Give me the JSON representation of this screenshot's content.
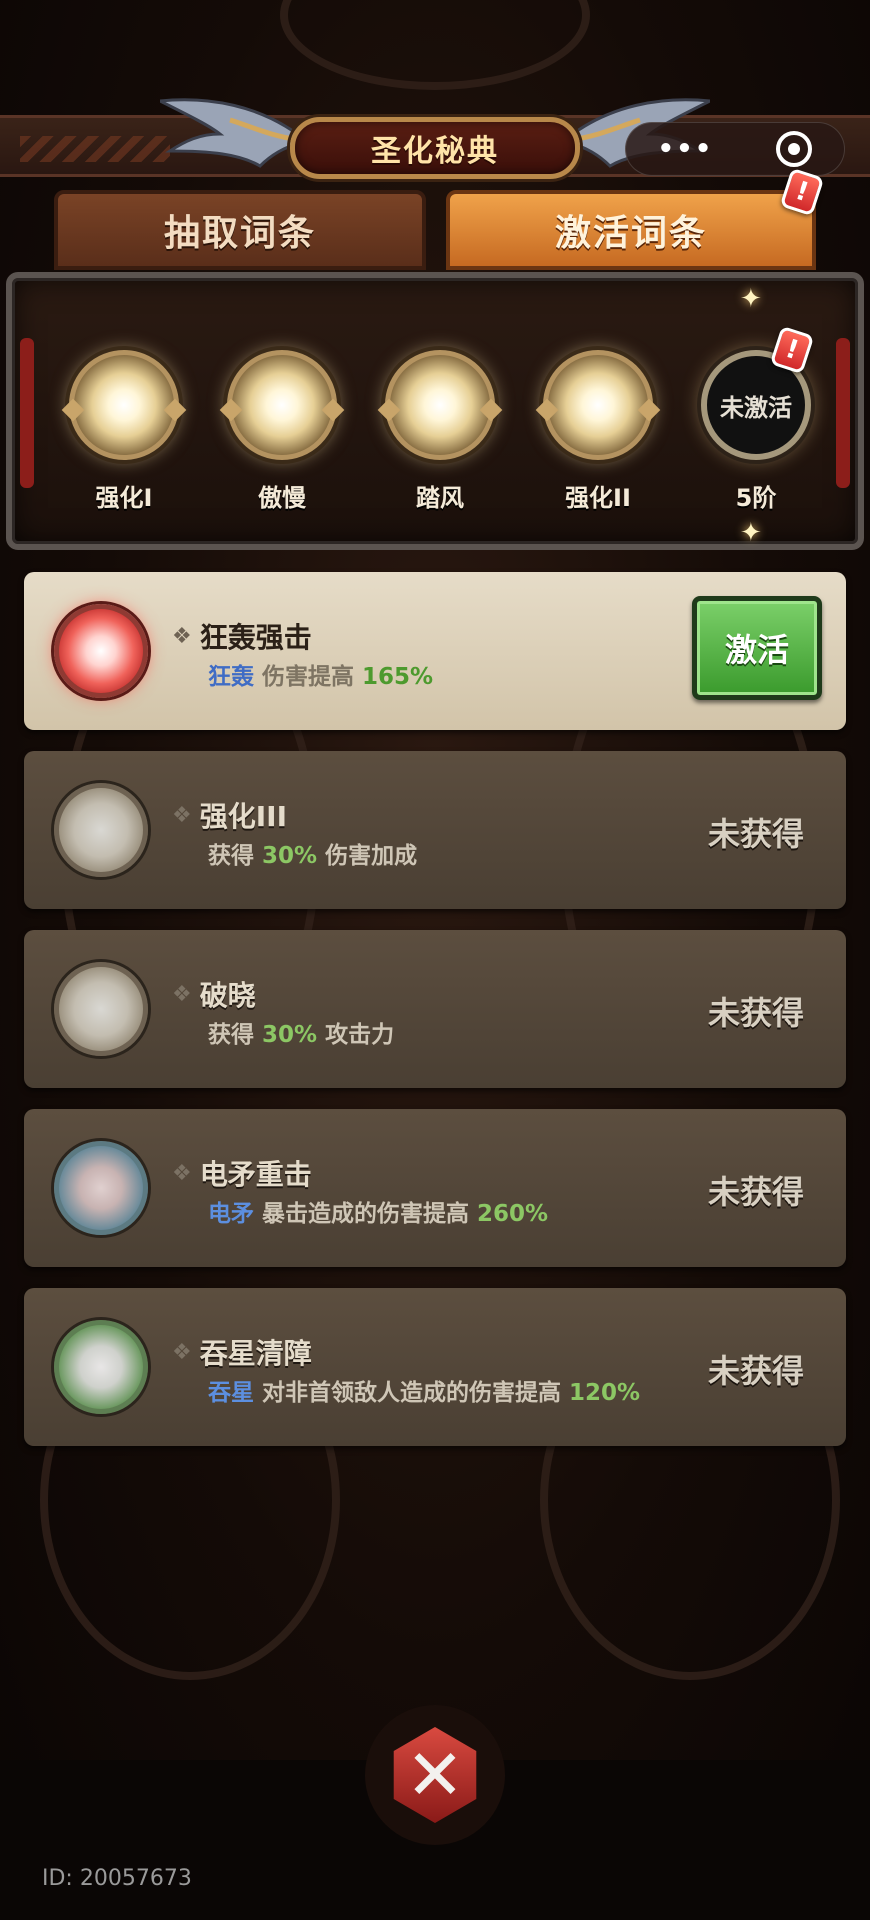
{
  "header": {
    "title": "圣化秘典"
  },
  "capsule": {
    "more": "•••"
  },
  "tabs": [
    {
      "label": "抽取词条"
    },
    {
      "label": "激活词条",
      "badge": "!"
    }
  ],
  "ranks": [
    {
      "label": "强化I"
    },
    {
      "label": "傲慢"
    },
    {
      "label": "踏风"
    },
    {
      "label": "强化II"
    },
    {
      "label": "5阶",
      "orb_text": "未激活",
      "badge": "!"
    }
  ],
  "entries": [
    {
      "name": "狂轰强击",
      "keyword": "狂轰",
      "text": "伤害提高",
      "value": "165%",
      "action": "激活",
      "gem": "red"
    },
    {
      "name": "强化III",
      "prefix": "获得",
      "value": "30%",
      "text": "伤害加成",
      "status": "未获得",
      "gem": "beige"
    },
    {
      "name": "破晓",
      "prefix": "获得",
      "value": "30%",
      "text": "攻击力",
      "status": "未获得",
      "gem": "beige"
    },
    {
      "name": "电矛重击",
      "keyword": "电矛",
      "text": "暴击造成的伤害提高",
      "value": "260%",
      "status": "未获得",
      "gem": "blue"
    },
    {
      "name": "吞星清障",
      "keyword": "吞星",
      "text": "对非首领敌人造成的伤害提高",
      "value": "120%",
      "status": "未获得",
      "gem": "green"
    }
  ],
  "footer": {
    "id": "ID: 20057673",
    "close": "✕"
  }
}
